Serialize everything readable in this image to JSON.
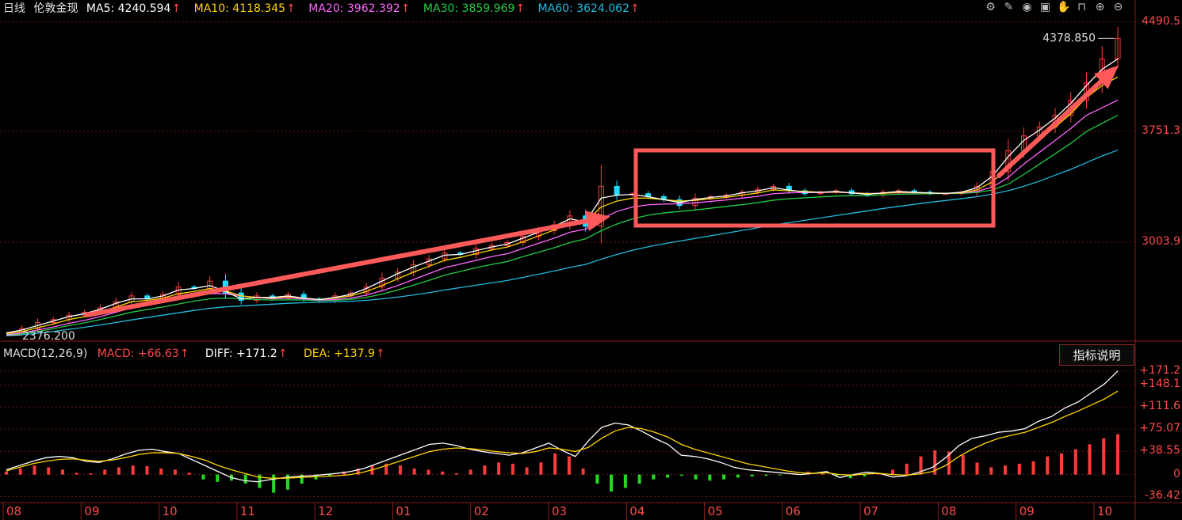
{
  "header": {
    "period": "日线",
    "symbol": "伦敦金现",
    "ma5": "MA5: 4240.594",
    "ma10": "MA10: 4118.345",
    "ma20": "MA20: 3962.392",
    "ma30": "MA30: 3859.969",
    "ma60": "MA60: 3624.062",
    "arrow": "↑"
  },
  "macd_header": {
    "name": "MACD(12,26,9)",
    "macd": "MACD: +66.63",
    "diff": "DIFF: +171.2",
    "dea": "DEA: +137.9",
    "arrow": "↑"
  },
  "indicator_button": "指标说明",
  "tools": [
    "gear-icon",
    "pencil-icon",
    "eye-icon",
    "briefcase-icon",
    "hand-icon",
    "lock-icon",
    "zoom-in-icon",
    "zoom-out-icon"
  ],
  "colors": {
    "ma5": "#ffffff",
    "ma10": "#ffd400",
    "ma20": "#ff66ff",
    "ma30": "#22cc44",
    "ma60": "#22bbdd",
    "up": "#ff3b3b",
    "down": "#22ddff",
    "axis": "#ff4a4a",
    "annot": "#ff5a5a"
  },
  "chart_data": [
    {
      "type": "candlestick",
      "title": "",
      "x_ticks": [
        "08",
        "09",
        "10",
        "11",
        "12",
        "01",
        "02",
        "03",
        "04",
        "05",
        "06",
        "07",
        "08",
        "09",
        "10"
      ],
      "y_ticks": [
        "4490.5",
        "3751.3",
        "3003.9"
      ],
      "y_tick_values": [
        4490.5,
        3751.3,
        3003.9
      ],
      "ylim": [
        2340,
        4520
      ],
      "annotations": {
        "high": "4378.850",
        "low": "2376.200"
      },
      "close_series": [
        2390,
        2420,
        2460,
        2480,
        2510,
        2530,
        2560,
        2600,
        2640,
        2620,
        2650,
        2700,
        2690,
        2740,
        2660,
        2610,
        2640,
        2630,
        2650,
        2620,
        2610,
        2640,
        2660,
        2700,
        2760,
        2800,
        2850,
        2890,
        2930,
        2920,
        2960,
        2980,
        3000,
        3040,
        3080,
        3120,
        3180,
        3110,
        3380,
        3320,
        3330,
        3310,
        3290,
        3250,
        3300,
        3310,
        3320,
        3340,
        3360,
        3380,
        3350,
        3330,
        3340,
        3350,
        3330,
        3320,
        3340,
        3350,
        3340,
        3330,
        3330,
        3340,
        3380,
        3480,
        3620,
        3720,
        3780,
        3860,
        3960,
        4080,
        4240,
        4378.85
      ],
      "ma5": [
        2390,
        2410,
        2440,
        2470,
        2500,
        2520,
        2550,
        2590,
        2620,
        2620,
        2640,
        2680,
        2690,
        2710,
        2670,
        2620,
        2630,
        2630,
        2640,
        2625,
        2615,
        2630,
        2650,
        2690,
        2740,
        2790,
        2835,
        2875,
        2915,
        2920,
        2945,
        2970,
        2990,
        3030,
        3070,
        3110,
        3160,
        3140,
        3300,
        3320,
        3325,
        3310,
        3290,
        3270,
        3290,
        3305,
        3315,
        3335,
        3350,
        3370,
        3355,
        3340,
        3340,
        3345,
        3335,
        3325,
        3335,
        3345,
        3340,
        3335,
        3332,
        3340,
        3370,
        3450,
        3580,
        3690,
        3760,
        3840,
        3940,
        4060,
        4170,
        4240.594
      ],
      "ma10": [
        2385,
        2400,
        2425,
        2450,
        2480,
        2500,
        2530,
        2565,
        2600,
        2610,
        2625,
        2655,
        2670,
        2690,
        2675,
        2640,
        2630,
        2625,
        2635,
        2625,
        2615,
        2625,
        2640,
        2670,
        2710,
        2755,
        2800,
        2840,
        2880,
        2900,
        2925,
        2950,
        2970,
        3005,
        3045,
        3085,
        3130,
        3140,
        3240,
        3280,
        3300,
        3300,
        3290,
        3280,
        3285,
        3295,
        3305,
        3320,
        3335,
        3355,
        3350,
        3345,
        3340,
        3342,
        3336,
        3330,
        3332,
        3340,
        3338,
        3334,
        3332,
        3336,
        3355,
        3410,
        3510,
        3620,
        3700,
        3780,
        3870,
        3980,
        4060,
        4118.345
      ],
      "ma20": [
        2380,
        2390,
        2410,
        2430,
        2455,
        2475,
        2500,
        2530,
        2560,
        2575,
        2595,
        2620,
        2640,
        2655,
        2655,
        2640,
        2630,
        2620,
        2625,
        2620,
        2612,
        2615,
        2625,
        2645,
        2675,
        2710,
        2750,
        2790,
        2830,
        2855,
        2880,
        2905,
        2925,
        2960,
        2995,
        3030,
        3070,
        3090,
        3160,
        3210,
        3240,
        3255,
        3260,
        3262,
        3268,
        3278,
        3288,
        3300,
        3312,
        3330,
        3336,
        3338,
        3338,
        3340,
        3336,
        3332,
        3333,
        3336,
        3336,
        3334,
        3333,
        3334,
        3345,
        3375,
        3440,
        3530,
        3610,
        3690,
        3770,
        3860,
        3910,
        3962.392
      ],
      "ma30": [
        2375,
        2385,
        2400,
        2418,
        2440,
        2458,
        2480,
        2505,
        2530,
        2548,
        2565,
        2585,
        2605,
        2620,
        2625,
        2620,
        2615,
        2612,
        2614,
        2612,
        2608,
        2610,
        2616,
        2630,
        2652,
        2680,
        2712,
        2745,
        2780,
        2805,
        2830,
        2852,
        2872,
        2905,
        2935,
        2965,
        3000,
        3025,
        3080,
        3125,
        3160,
        3185,
        3200,
        3210,
        3220,
        3232,
        3244,
        3256,
        3270,
        3286,
        3296,
        3302,
        3308,
        3314,
        3316,
        3318,
        3322,
        3326,
        3328,
        3330,
        3331,
        3332,
        3338,
        3355,
        3395,
        3460,
        3530,
        3600,
        3670,
        3750,
        3805,
        3859.969
      ],
      "ma60": [
        2370,
        2378,
        2388,
        2400,
        2414,
        2428,
        2444,
        2460,
        2478,
        2494,
        2510,
        2526,
        2542,
        2556,
        2566,
        2572,
        2578,
        2584,
        2590,
        2594,
        2597,
        2600,
        2604,
        2610,
        2620,
        2632,
        2646,
        2662,
        2680,
        2696,
        2712,
        2728,
        2744,
        2765,
        2786,
        2808,
        2832,
        2852,
        2888,
        2920,
        2948,
        2972,
        2992,
        3010,
        3028,
        3046,
        3064,
        3082,
        3100,
        3118,
        3134,
        3150,
        3166,
        3182,
        3198,
        3214,
        3230,
        3244,
        3258,
        3272,
        3284,
        3296,
        3310,
        3328,
        3350,
        3380,
        3415,
        3455,
        3495,
        3540,
        3585,
        3624.062
      ]
    },
    {
      "type": "bar",
      "title": "",
      "x_ticks": [
        "08",
        "09",
        "10",
        "11",
        "12",
        "01",
        "02",
        "03",
        "04",
        "05",
        "06",
        "07",
        "08",
        "09",
        "10"
      ],
      "y_ticks": [
        "+171.2",
        "+148.1",
        "+111.6",
        "+75.07",
        "+38.55",
        "0",
        "-36.42"
      ],
      "y_tick_values": [
        171.2,
        148.1,
        111.6,
        75.07,
        38.55,
        0,
        -36.42
      ],
      "ylim": [
        -45,
        180
      ],
      "series": [
        {
          "name": "MACD",
          "values": [
            5,
            10,
            15,
            12,
            8,
            3,
            2,
            8,
            12,
            15,
            14,
            10,
            8,
            3,
            -8,
            -12,
            -10,
            -15,
            -22,
            -30,
            -25,
            -15,
            -8,
            -2,
            5,
            10,
            15,
            18,
            15,
            10,
            8,
            5,
            2,
            8,
            15,
            20,
            18,
            12,
            20,
            35,
            30,
            10,
            -15,
            -28,
            -22,
            -15,
            -8,
            -5,
            -2,
            -8,
            -10,
            -8,
            -5,
            -3,
            -2,
            -1,
            2,
            5,
            3,
            -2,
            -6,
            -3,
            2,
            8,
            18,
            30,
            40,
            38,
            32,
            20,
            12,
            15,
            18,
            22,
            30,
            35,
            42,
            50,
            60,
            66.63
          ]
        },
        {
          "name": "DIFF",
          "values": [
            8,
            15,
            22,
            28,
            30,
            28,
            22,
            20,
            26,
            34,
            40,
            42,
            38,
            35,
            25,
            15,
            5,
            -5,
            -10,
            -12,
            -8,
            -5,
            -3,
            -2,
            0,
            2,
            5,
            10,
            18,
            26,
            34,
            42,
            50,
            52,
            48,
            42,
            38,
            35,
            32,
            36,
            44,
            52,
            40,
            30,
            56,
            78,
            85,
            82,
            72,
            60,
            50,
            32,
            30,
            26,
            20,
            12,
            8,
            6,
            4,
            2,
            0,
            2,
            5,
            -5,
            0,
            4,
            2,
            -4,
            -2,
            4,
            12,
            28,
            48,
            60,
            64,
            70,
            72,
            76,
            88,
            96,
            110,
            120,
            135,
            150,
            171.2
          ]
        },
        {
          "name": "DEA",
          "values": [
            6,
            12,
            18,
            22,
            25,
            26,
            24,
            22,
            24,
            28,
            33,
            36,
            36,
            35,
            30,
            24,
            15,
            8,
            2,
            -4,
            -6,
            -6,
            -5,
            -4,
            -3,
            -2,
            0,
            4,
            10,
            17,
            24,
            31,
            38,
            42,
            44,
            43,
            41,
            38,
            36,
            35,
            38,
            44,
            42,
            38,
            45,
            60,
            72,
            78,
            76,
            70,
            62,
            50,
            42,
            36,
            30,
            24,
            18,
            14,
            10,
            6,
            3,
            2,
            3,
            0,
            -1,
            1,
            2,
            0,
            -1,
            1,
            5,
            15,
            30,
            42,
            52,
            60,
            65,
            70,
            78,
            86,
            96,
            105,
            115,
            125,
            137.9
          ]
        }
      ]
    }
  ]
}
